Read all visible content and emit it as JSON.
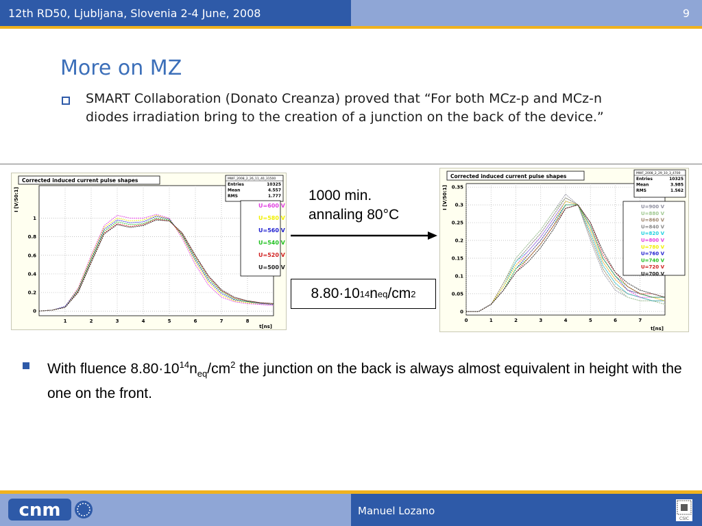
{
  "header": {
    "conference": "12th  RD50, Ljubljana, Slovenia 2-4 June, 2008",
    "page_number": "9"
  },
  "slide": {
    "title": "More on MZ",
    "paragraph": "SMART Collaboration (Donato Creanza) proved that “For both MCz-p and MCz-n diodes irradiation bring to the creation of a junction on the back of the device.”"
  },
  "annotation": {
    "line1": "1000 min.",
    "line2": "annaling 80°C"
  },
  "fluence": {
    "base": "8.80·10",
    "exponent": "14",
    "n": "n",
    "sub": "eq",
    "unit": "/cm",
    "unit_exp": "2"
  },
  "conclusion": {
    "pre": "With fluence 8.80·10",
    "exp": "14",
    "n": "n",
    "sub": "eq",
    "unit": "/cm",
    "unit_exp": "2",
    "post": " the junction on the back is always almost equivalent in height with the one on the front."
  },
  "footer": {
    "author": "Manuel Lozano",
    "logo_text": "cnm",
    "badge_text": "CSIC"
  },
  "colors": {
    "header_blue": "#2e5aa8",
    "header_light": "#8fa6d6",
    "stripe": "#f0b21e",
    "title": "#3c6fb9"
  },
  "chart_data": [
    {
      "type": "line",
      "title": "Corrected induced current pulse shapes",
      "xlabel": "t[ns]",
      "ylabel": "I [V/50:1]",
      "xlim": [
        0,
        9
      ],
      "ylim": [
        -0.05,
        1.35
      ],
      "xticks": [
        "1",
        "2",
        "3",
        "4",
        "5",
        "6",
        "7",
        "8"
      ],
      "xtick_values": [
        1,
        2,
        3,
        4,
        5,
        6,
        7,
        8
      ],
      "yticks": [
        "0",
        "0.2",
        "0.4",
        "0.6",
        "0.8",
        "1"
      ],
      "ytick_values": [
        0,
        0.2,
        0.4,
        0.6,
        0.8,
        1
      ],
      "stats": {
        "name": "MWF_2008_2_26_11_40_31500",
        "rows": [
          [
            "Entries",
            "10325"
          ],
          [
            "Mean",
            "4.557"
          ],
          [
            "RMS",
            "1.777"
          ]
        ]
      },
      "series": [
        {
          "name": "U=600 V",
          "color": "#e040e0",
          "x": [
            0,
            0.5,
            1,
            1.5,
            2,
            2.5,
            3,
            3.5,
            4,
            4.5,
            5,
            5.5,
            6,
            6.5,
            7,
            7.5,
            8,
            8.5,
            9
          ],
          "y": [
            0,
            0.01,
            0.05,
            0.25,
            0.6,
            0.92,
            1.03,
            1.0,
            1.0,
            1.04,
            1.0,
            0.78,
            0.5,
            0.28,
            0.15,
            0.1,
            0.08,
            0.07,
            0.06
          ]
        },
        {
          "name": "U=580 V",
          "color": "#f0f000",
          "x": [
            0,
            0.5,
            1,
            1.5,
            2,
            2.5,
            3,
            3.5,
            4,
            4.5,
            5,
            5.5,
            6,
            6.5,
            7,
            7.5,
            8,
            8.5,
            9
          ],
          "y": [
            0,
            0.01,
            0.05,
            0.24,
            0.58,
            0.9,
            1.0,
            0.97,
            0.98,
            1.03,
            0.99,
            0.8,
            0.53,
            0.31,
            0.17,
            0.11,
            0.09,
            0.08,
            0.07
          ]
        },
        {
          "name": "U=560 V",
          "color": "#2020d0",
          "x": [
            0,
            0.5,
            1,
            1.5,
            2,
            2.5,
            3,
            3.5,
            4,
            4.5,
            5,
            5.5,
            6,
            6.5,
            7,
            7.5,
            8,
            8.5,
            9
          ],
          "y": [
            0,
            0.01,
            0.05,
            0.23,
            0.56,
            0.88,
            0.98,
            0.95,
            0.96,
            1.02,
            0.99,
            0.81,
            0.55,
            0.33,
            0.19,
            0.12,
            0.1,
            0.08,
            0.07
          ]
        },
        {
          "name": "U=540 V",
          "color": "#20c020",
          "x": [
            0,
            0.5,
            1,
            1.5,
            2,
            2.5,
            3,
            3.5,
            4,
            4.5,
            5,
            5.5,
            6,
            6.5,
            7,
            7.5,
            8,
            8.5,
            9
          ],
          "y": [
            0,
            0.01,
            0.04,
            0.22,
            0.55,
            0.86,
            0.96,
            0.93,
            0.94,
            1.0,
            0.98,
            0.82,
            0.57,
            0.35,
            0.21,
            0.13,
            0.1,
            0.09,
            0.08
          ]
        },
        {
          "name": "U=520 V",
          "color": "#d02020",
          "x": [
            0,
            0.5,
            1,
            1.5,
            2,
            2.5,
            3,
            3.5,
            4,
            4.5,
            5,
            5.5,
            6,
            6.5,
            7,
            7.5,
            8,
            8.5,
            9
          ],
          "y": [
            0,
            0.01,
            0.04,
            0.21,
            0.53,
            0.84,
            0.94,
            0.91,
            0.93,
            0.99,
            0.97,
            0.83,
            0.59,
            0.37,
            0.22,
            0.14,
            0.11,
            0.09,
            0.08
          ]
        },
        {
          "name": "U=500 V",
          "color": "#202020",
          "x": [
            0,
            0.5,
            1,
            1.5,
            2,
            2.5,
            3,
            3.5,
            4,
            4.5,
            5,
            5.5,
            6,
            6.5,
            7,
            7.5,
            8,
            8.5,
            9
          ],
          "y": [
            0,
            0.01,
            0.04,
            0.2,
            0.52,
            0.83,
            0.93,
            0.9,
            0.92,
            0.98,
            0.97,
            0.84,
            0.6,
            0.38,
            0.23,
            0.15,
            0.11,
            0.09,
            0.08
          ]
        }
      ]
    },
    {
      "type": "line",
      "title": "Corrected induced current pulse shapes",
      "xlabel": "t[ns]",
      "ylabel": "I [V/50:1]",
      "xlim": [
        0,
        8
      ],
      "ylim": [
        -0.01,
        0.36
      ],
      "xticks": [
        "0",
        "1",
        "2",
        "3",
        "4",
        "5",
        "6",
        "7"
      ],
      "xtick_values": [
        0,
        1,
        2,
        3,
        4,
        5,
        6,
        7
      ],
      "yticks": [
        "0",
        "0.05",
        "0.1",
        "0.15",
        "0.2",
        "0.25",
        "0.3",
        "0.35"
      ],
      "ytick_values": [
        0,
        0.05,
        0.1,
        0.15,
        0.2,
        0.25,
        0.3,
        0.35
      ],
      "stats": {
        "name": "MWF_2008_2_29_10_3_4700",
        "rows": [
          [
            "Entries",
            "10325"
          ],
          [
            "Mean",
            "3.985"
          ],
          [
            "RMS",
            "1.562"
          ]
        ]
      },
      "series": [
        {
          "name": "U=900 V",
          "color": "#9090a0",
          "x": [
            0,
            0.5,
            1,
            1.5,
            2,
            2.5,
            3,
            3.5,
            4,
            4.5,
            5,
            5.5,
            6,
            6.5,
            7,
            7.5,
            8
          ],
          "y": [
            0,
            0,
            0.02,
            0.08,
            0.15,
            0.19,
            0.23,
            0.28,
            0.33,
            0.3,
            0.2,
            0.11,
            0.06,
            0.04,
            0.03,
            0.03,
            0.02
          ]
        },
        {
          "name": "U=880 V",
          "color": "#a0c890",
          "x": [
            0,
            0.5,
            1,
            1.5,
            2,
            2.5,
            3,
            3.5,
            4,
            4.5,
            5,
            5.5,
            6,
            6.5,
            7,
            7.5,
            8
          ],
          "y": [
            0,
            0,
            0.02,
            0.08,
            0.15,
            0.19,
            0.23,
            0.28,
            0.32,
            0.3,
            0.21,
            0.12,
            0.07,
            0.04,
            0.03,
            0.03,
            0.02
          ]
        },
        {
          "name": "U=860 V",
          "color": "#a08870",
          "x": [
            0,
            0.5,
            1,
            1.5,
            2,
            2.5,
            3,
            3.5,
            4,
            4.5,
            5,
            5.5,
            6,
            6.5,
            7,
            7.5,
            8
          ],
          "y": [
            0,
            0,
            0.02,
            0.08,
            0.14,
            0.18,
            0.22,
            0.27,
            0.32,
            0.3,
            0.21,
            0.12,
            0.07,
            0.05,
            0.04,
            0.03,
            0.03
          ]
        },
        {
          "name": "U=840 V",
          "color": "#888888",
          "x": [
            0,
            0.5,
            1,
            1.5,
            2,
            2.5,
            3,
            3.5,
            4,
            4.5,
            5,
            5.5,
            6,
            6.5,
            7,
            7.5,
            8
          ],
          "y": [
            0,
            0,
            0.02,
            0.07,
            0.14,
            0.18,
            0.22,
            0.27,
            0.32,
            0.3,
            0.22,
            0.13,
            0.08,
            0.05,
            0.04,
            0.03,
            0.03
          ]
        },
        {
          "name": "U=820 V",
          "color": "#20d0e0",
          "x": [
            0,
            0.5,
            1,
            1.5,
            2,
            2.5,
            3,
            3.5,
            4,
            4.5,
            5,
            5.5,
            6,
            6.5,
            7,
            7.5,
            8
          ],
          "y": [
            0,
            0,
            0.02,
            0.07,
            0.14,
            0.17,
            0.21,
            0.26,
            0.31,
            0.3,
            0.22,
            0.13,
            0.08,
            0.05,
            0.04,
            0.03,
            0.03
          ]
        },
        {
          "name": "U=800 V",
          "color": "#e040e0",
          "x": [
            0,
            0.5,
            1,
            1.5,
            2,
            2.5,
            3,
            3.5,
            4,
            4.5,
            5,
            5.5,
            6,
            6.5,
            7,
            7.5,
            8
          ],
          "y": [
            0,
            0,
            0.02,
            0.07,
            0.13,
            0.17,
            0.21,
            0.26,
            0.31,
            0.3,
            0.23,
            0.14,
            0.09,
            0.06,
            0.04,
            0.04,
            0.03
          ]
        },
        {
          "name": "U=780 V",
          "color": "#f0f000",
          "x": [
            0,
            0.5,
            1,
            1.5,
            2,
            2.5,
            3,
            3.5,
            4,
            4.5,
            5,
            5.5,
            6,
            6.5,
            7,
            7.5,
            8
          ],
          "y": [
            0,
            0,
            0.02,
            0.07,
            0.13,
            0.16,
            0.2,
            0.25,
            0.31,
            0.3,
            0.23,
            0.14,
            0.09,
            0.06,
            0.05,
            0.04,
            0.03
          ]
        },
        {
          "name": "U=760 V",
          "color": "#2020d0",
          "x": [
            0,
            0.5,
            1,
            1.5,
            2,
            2.5,
            3,
            3.5,
            4,
            4.5,
            5,
            5.5,
            6,
            6.5,
            7,
            7.5,
            8
          ],
          "y": [
            0,
            0,
            0.02,
            0.06,
            0.12,
            0.16,
            0.2,
            0.25,
            0.3,
            0.3,
            0.24,
            0.15,
            0.1,
            0.06,
            0.05,
            0.04,
            0.04
          ]
        },
        {
          "name": "U=740 V",
          "color": "#20c020",
          "x": [
            0,
            0.5,
            1,
            1.5,
            2,
            2.5,
            3,
            3.5,
            4,
            4.5,
            5,
            5.5,
            6,
            6.5,
            7,
            7.5,
            8
          ],
          "y": [
            0,
            0,
            0.02,
            0.06,
            0.12,
            0.15,
            0.19,
            0.24,
            0.3,
            0.3,
            0.24,
            0.15,
            0.1,
            0.07,
            0.05,
            0.04,
            0.04
          ]
        },
        {
          "name": "U=720 V",
          "color": "#d02020",
          "x": [
            0,
            0.5,
            1,
            1.5,
            2,
            2.5,
            3,
            3.5,
            4,
            4.5,
            5,
            5.5,
            6,
            6.5,
            7,
            7.5,
            8
          ],
          "y": [
            0,
            0,
            0.02,
            0.06,
            0.11,
            0.15,
            0.19,
            0.24,
            0.29,
            0.3,
            0.25,
            0.16,
            0.11,
            0.07,
            0.05,
            0.05,
            0.04
          ]
        },
        {
          "name": "U=700 V",
          "color": "#202020",
          "x": [
            0,
            0.5,
            1,
            1.5,
            2,
            2.5,
            3,
            3.5,
            4,
            4.5,
            5,
            5.5,
            6,
            6.5,
            7,
            7.5,
            8
          ],
          "y": [
            0,
            0,
            0.02,
            0.06,
            0.11,
            0.14,
            0.18,
            0.23,
            0.29,
            0.3,
            0.25,
            0.17,
            0.11,
            0.08,
            0.06,
            0.05,
            0.04
          ]
        }
      ]
    }
  ]
}
